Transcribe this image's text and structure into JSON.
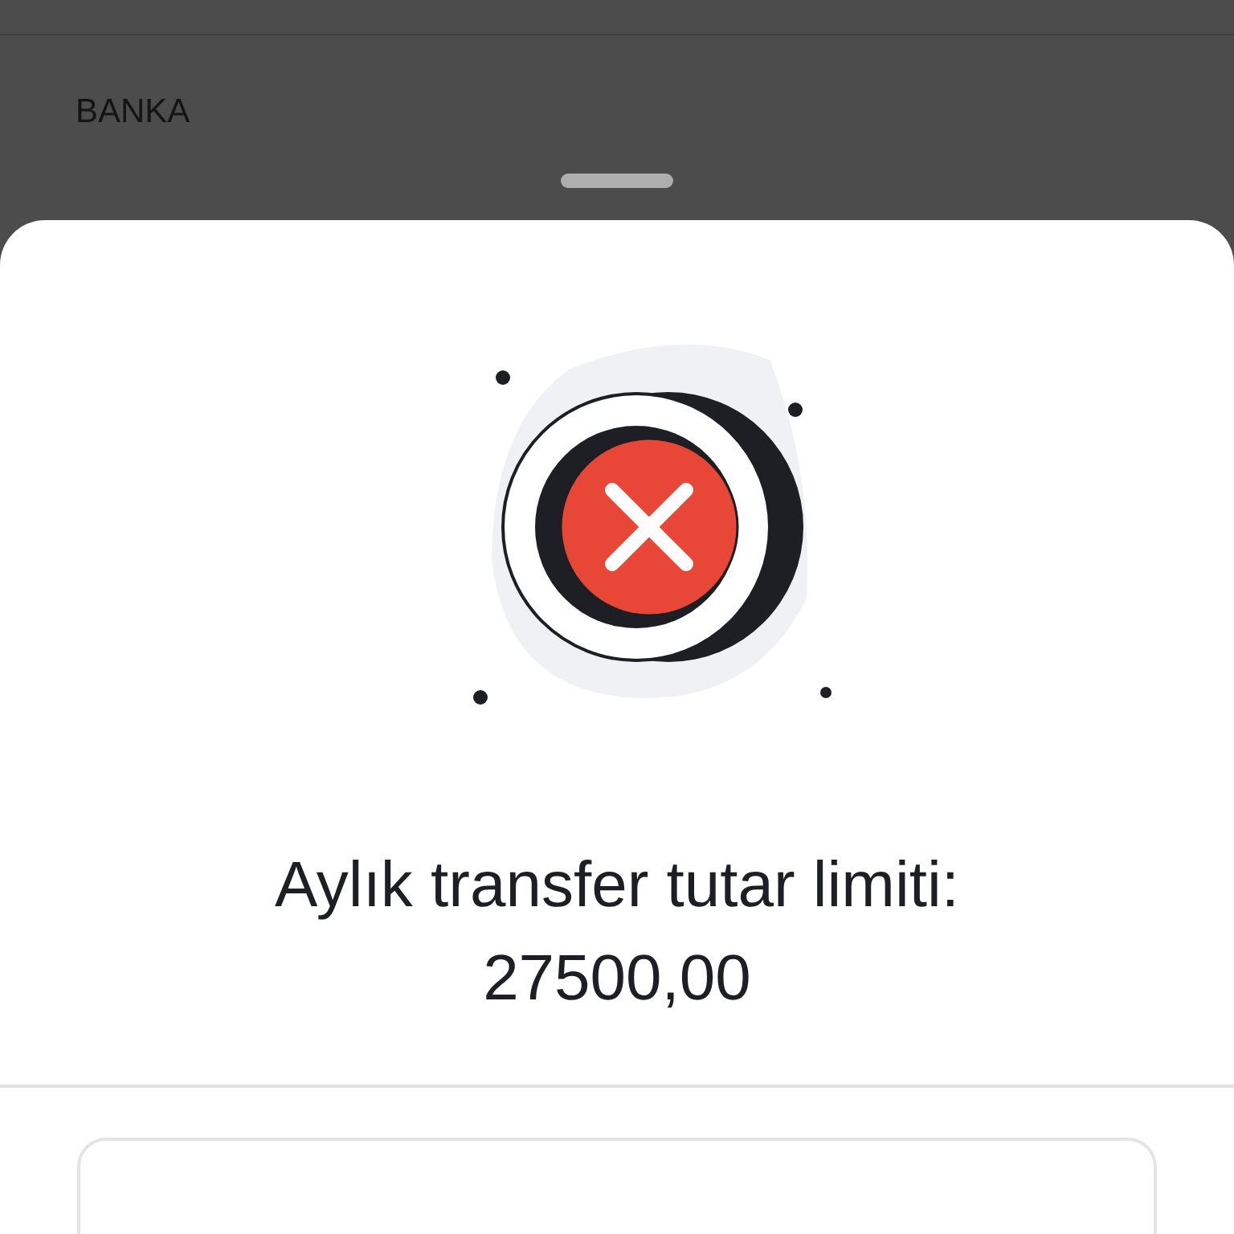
{
  "background": {
    "label": "BANKA"
  },
  "sheet": {
    "title": "Aylık transfer tutar limiti:",
    "amount": "27500,00"
  }
}
